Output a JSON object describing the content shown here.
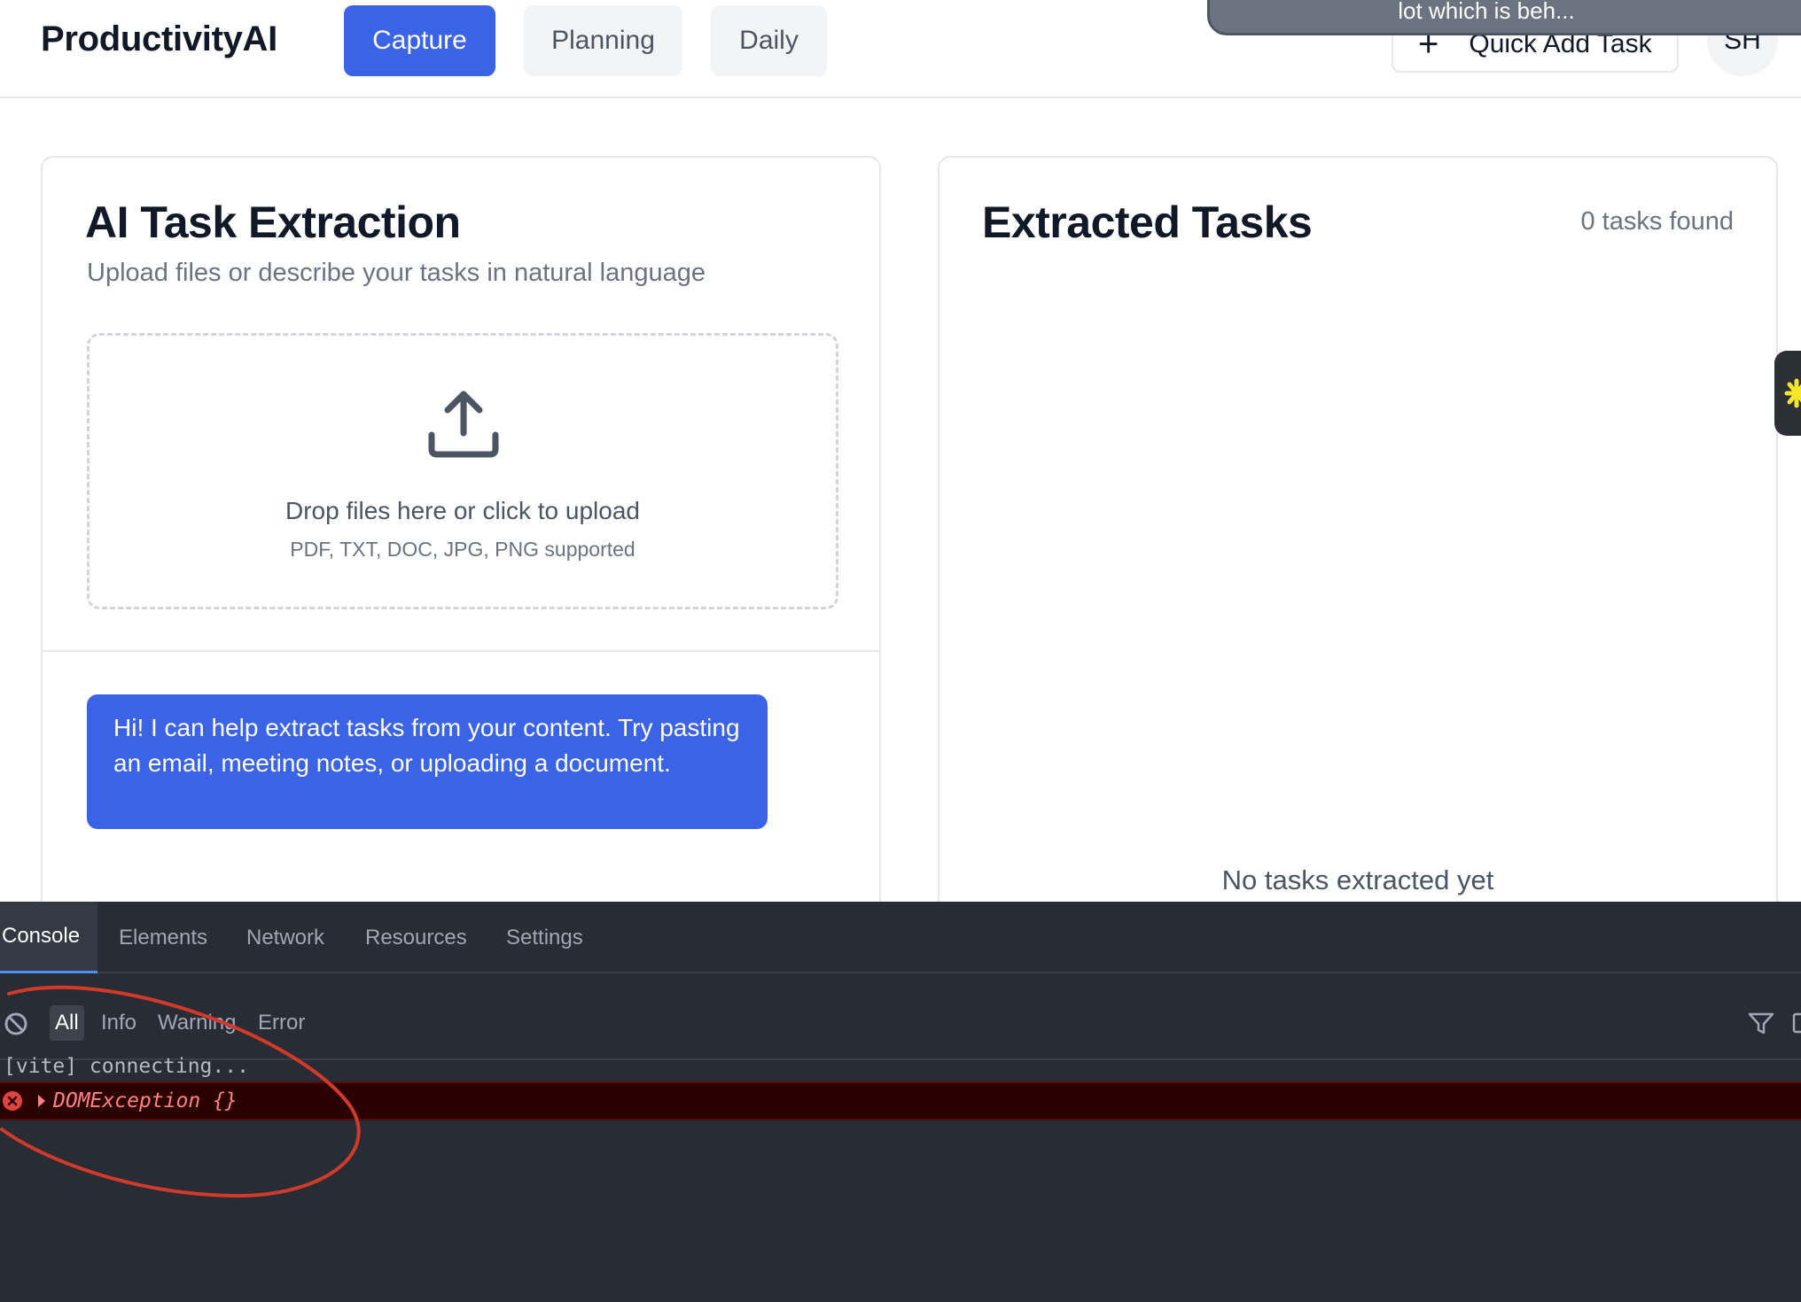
{
  "header": {
    "logo": "ProductivityAI",
    "tabs": [
      {
        "label": "Capture",
        "active": true
      },
      {
        "label": "Planning",
        "active": false
      },
      {
        "label": "Daily",
        "active": false
      }
    ],
    "quick_add_label": "Quick Add Task",
    "avatar_initials": "SH",
    "toast_text": "lot which is beh..."
  },
  "extraction": {
    "title": "AI Task Extraction",
    "subtitle": "Upload files or describe your tasks in natural language",
    "dropzone_text": "Drop files here or click to upload",
    "dropzone_formats": "PDF, TXT, DOC, JPG, PNG supported",
    "assistant_message": "Hi! I can help extract tasks from your content. Try pasting an email, meeting notes, or uploading a document."
  },
  "extracted": {
    "title": "Extracted Tasks",
    "count_label": "0 tasks found",
    "empty_text": "No tasks extracted yet"
  },
  "devtools": {
    "tabs": [
      "Console",
      "Elements",
      "Network",
      "Resources",
      "Settings"
    ],
    "active_tab": "Console",
    "filters": [
      "All",
      "Info",
      "Warning",
      "Error"
    ],
    "active_filter": "All",
    "logs": [
      {
        "level": "info",
        "text": "[vite] connecting..."
      },
      {
        "level": "error",
        "text": "DOMException {}"
      }
    ]
  },
  "colors": {
    "accent": "#3b63e6",
    "annotation": "#d13a2a",
    "error_bg": "#2a0000",
    "error_text": "#ff8080"
  }
}
